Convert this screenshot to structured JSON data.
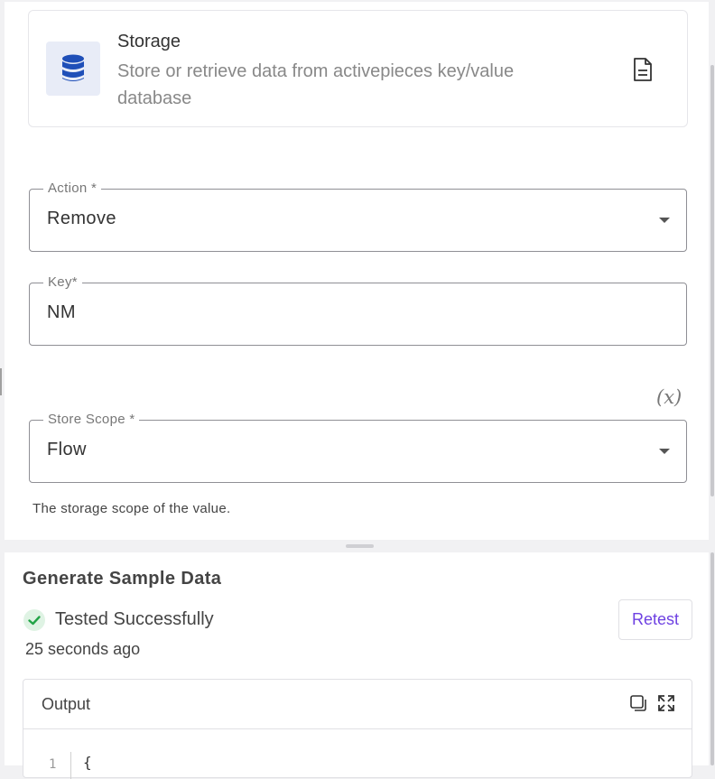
{
  "piece": {
    "title": "Storage",
    "description": "Store or retrieve data from activepieces key/value database",
    "logo_color": "#1f4fb8",
    "logo_icon": "database-icon",
    "docs_icon": "document-icon"
  },
  "fields": {
    "action": {
      "label": "Action *",
      "value": "Remove"
    },
    "key": {
      "label": "Key*",
      "value": "NM"
    },
    "store_scope": {
      "label": "Store Scope *",
      "value": "Flow",
      "helper": "The storage scope of the value."
    }
  },
  "variable_toggle": "(x)",
  "sample": {
    "title": "Generate Sample Data",
    "status": "Tested Successfully",
    "time_ago": "25 seconds ago",
    "retest_label": "Retest",
    "output_label": "Output",
    "code": {
      "line_number": "1",
      "first_line": "{"
    }
  },
  "colors": {
    "accent": "#6e41e2",
    "success": "#22a447",
    "success_bg": "#dff3e4"
  }
}
